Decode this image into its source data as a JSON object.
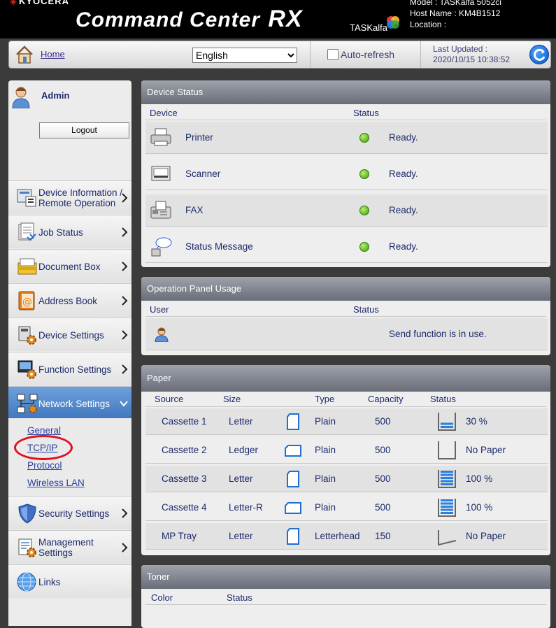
{
  "header": {
    "brand": "KYOCERA",
    "app_title": "Command Center",
    "app_title_suffix": "RX",
    "product": "TASKalfa",
    "model_line": "Model : TASKalfa 5052ci",
    "host_line": "Host Name : KM4B1512",
    "location_line": "Location :"
  },
  "toolbar": {
    "home_label": "Home",
    "language": "English",
    "auto_refresh_label": "Auto-refresh",
    "auto_refresh_checked": false,
    "last_updated_label": "Last Updated :",
    "last_updated_value": "2020/10/15 10:38:52"
  },
  "sidebar": {
    "user": "Admin",
    "logout_label": "Logout",
    "items": [
      {
        "label_line1": "Device Information /",
        "label_line2": "Remote Operation",
        "icon": "device-info-icon"
      },
      {
        "label_line1": "Job Status",
        "label_line2": "",
        "icon": "job-status-icon"
      },
      {
        "label_line1": "Document Box",
        "label_line2": "",
        "icon": "document-box-icon"
      },
      {
        "label_line1": "Address Book",
        "label_line2": "",
        "icon": "address-book-icon"
      },
      {
        "label_line1": "Device Settings",
        "label_line2": "",
        "icon": "device-settings-icon"
      },
      {
        "label_line1": "Function Settings",
        "label_line2": "",
        "icon": "function-settings-icon"
      },
      {
        "label_line1": "Network Settings",
        "label_line2": "",
        "icon": "network-settings-icon"
      },
      {
        "label_line1": "Security Settings",
        "label_line2": "",
        "icon": "security-settings-icon"
      },
      {
        "label_line1": "Management",
        "label_line2": "Settings",
        "icon": "management-settings-icon"
      },
      {
        "label_line1": "Links",
        "label_line2": "",
        "icon": "links-icon"
      }
    ],
    "network_submenu": [
      "General",
      "TCP/IP",
      "Protocol",
      "Wireless LAN"
    ]
  },
  "device_status": {
    "title": "Device Status",
    "col_device": "Device",
    "col_status": "Status",
    "rows": [
      {
        "device": "Printer",
        "status": "Ready."
      },
      {
        "device": "Scanner",
        "status": "Ready."
      },
      {
        "device": "FAX",
        "status": "Ready."
      },
      {
        "device": "Status Message",
        "status": "Ready."
      }
    ]
  },
  "operation_panel": {
    "title": "Operation Panel Usage",
    "col_user": "User",
    "col_status": "Status",
    "status": "Send function is in use."
  },
  "paper": {
    "title": "Paper",
    "columns": [
      "Source",
      "Size",
      "Type",
      "Capacity",
      "Status"
    ],
    "rows": [
      {
        "source": "Cassette 1",
        "size": "Letter",
        "orientation": "portrait",
        "type": "Plain",
        "capacity": "500",
        "level": 0.3,
        "status": "30 %"
      },
      {
        "source": "Cassette 2",
        "size": "Ledger",
        "orientation": "landscape",
        "type": "Plain",
        "capacity": "500",
        "level": 0,
        "status": "No Paper"
      },
      {
        "source": "Cassette 3",
        "size": "Letter",
        "orientation": "portrait",
        "type": "Plain",
        "capacity": "500",
        "level": 1,
        "status": "100 %"
      },
      {
        "source": "Cassette 4",
        "size": "Letter-R",
        "orientation": "landscape",
        "type": "Plain",
        "capacity": "500",
        "level": 1,
        "status": "100 %"
      },
      {
        "source": "MP Tray",
        "size": "Letter",
        "orientation": "portrait",
        "type": "Letterhead",
        "capacity": "150",
        "level": 0,
        "status": "No Paper"
      }
    ]
  },
  "toner": {
    "title": "Toner",
    "col_color": "Color",
    "col_status": "Status"
  }
}
